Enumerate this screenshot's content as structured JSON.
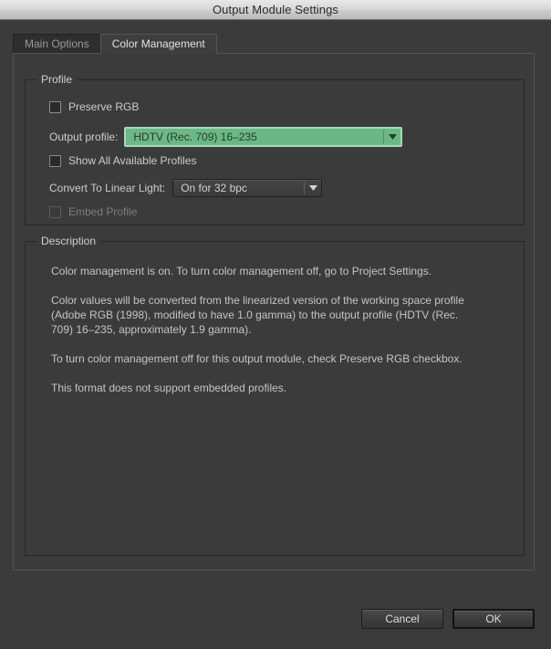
{
  "window": {
    "title": "Output Module Settings"
  },
  "tabs": [
    {
      "label": "Main Options",
      "active": false
    },
    {
      "label": "Color Management",
      "active": true
    }
  ],
  "profile_group": {
    "legend": "Profile",
    "preserve_rgb": {
      "label": "Preserve RGB",
      "checked": false
    },
    "output_profile": {
      "label": "Output profile:",
      "value": "HDTV (Rec. 709) 16–235",
      "highlight_color": "#6cb786"
    },
    "show_all_profiles": {
      "label": "Show All Available Profiles",
      "checked": false
    },
    "convert_to_linear_light": {
      "label": "Convert To Linear Light:",
      "value": "On for 32 bpc"
    },
    "embed_profile": {
      "label": "Embed Profile",
      "checked": false,
      "disabled": true
    }
  },
  "description_group": {
    "legend": "Description",
    "paragraphs": [
      "Color management is on. To turn color management off, go to Project Settings.",
      "Color values will be converted from the linearized version of the working space profile (Adobe RGB (1998), modified to have 1.0 gamma) to the output profile (HDTV (Rec. 709) 16–235, approximately 1.9 gamma).",
      "To turn color management off for this output module, check Preserve RGB checkbox.",
      "This format does not support embedded profiles."
    ]
  },
  "footer": {
    "cancel_label": "Cancel",
    "ok_label": "OK"
  }
}
